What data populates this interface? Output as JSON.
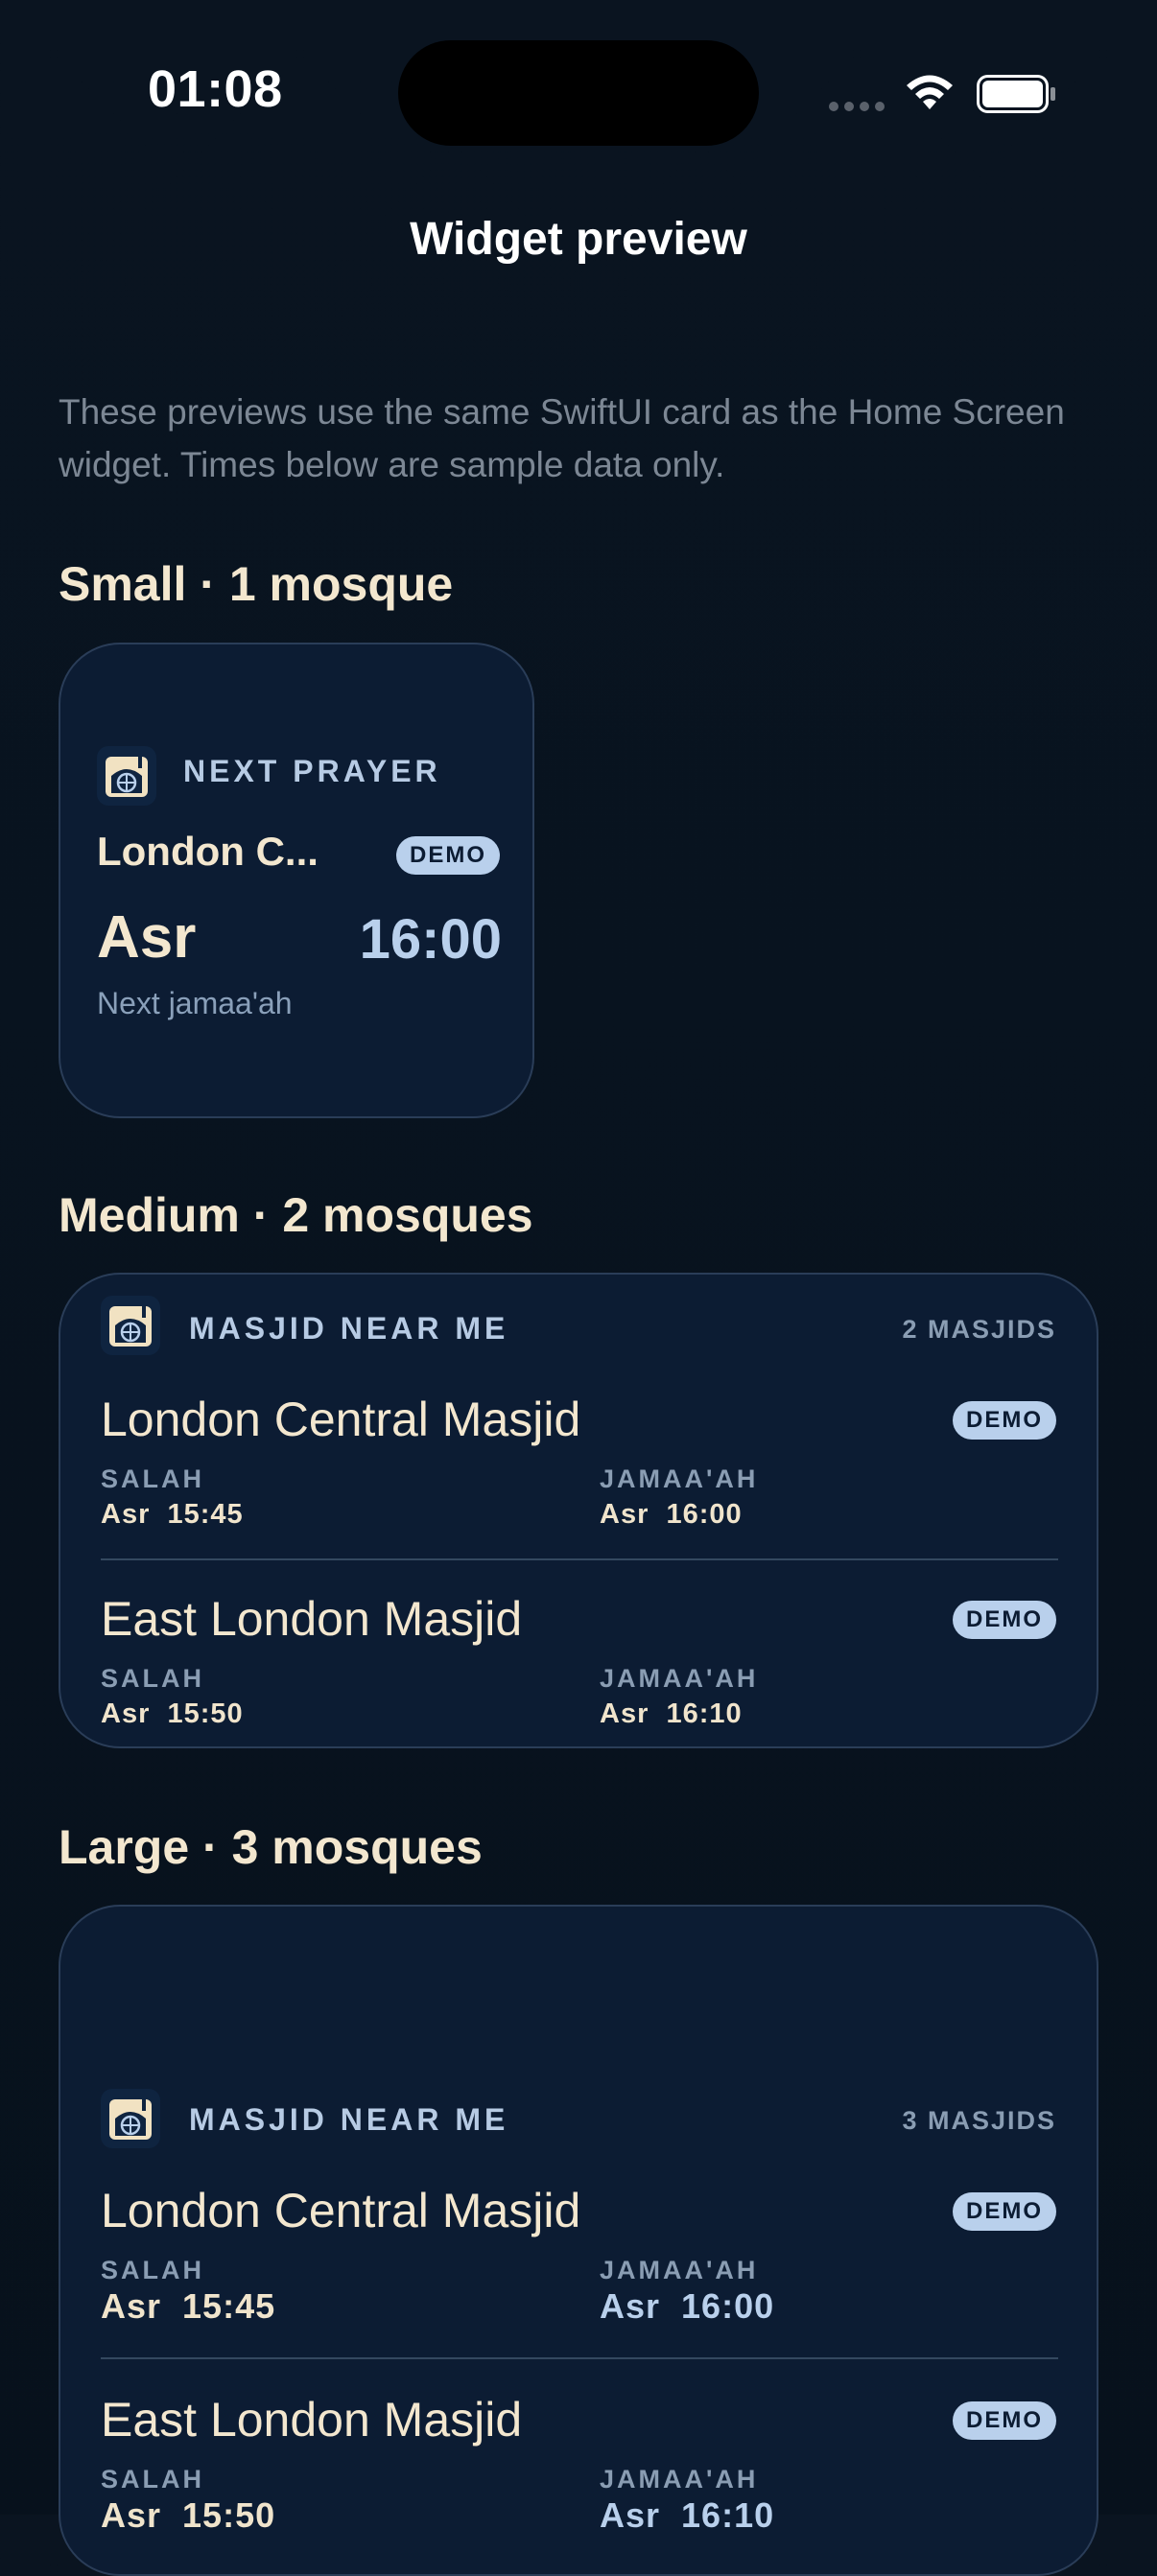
{
  "status_bar": {
    "time": "01:08"
  },
  "nav": {
    "title": "Widget preview"
  },
  "description": "These previews use the same SwiftUI card as the Home Screen widget. Times below are sample data only.",
  "colors": {
    "background": "#08131f",
    "card": "#0c1c33",
    "accent_cream": "#f3e7cf",
    "accent_blue": "#b9d0ec"
  },
  "small": {
    "section_title": "Small · 1 mosque",
    "kicker": "NEXT PRAYER",
    "mosque": "London C...",
    "badge": "DEMO",
    "prayer": "Asr",
    "time": "16:00",
    "caption": "Next jamaa'ah"
  },
  "medium": {
    "section_title": "Medium · 2 mosques",
    "kicker": "MASJID NEAR ME",
    "count": "2 MASJIDS",
    "mosques": [
      {
        "name": "London Central Masjid",
        "badge": "DEMO",
        "salah_label": "SALAH",
        "salah": "Asr  15:45",
        "jamaah_label": "JAMAA'AH",
        "jamaah": "Asr  16:00"
      },
      {
        "name": "East London Masjid",
        "badge": "DEMO",
        "salah_label": "SALAH",
        "salah": "Asr  15:50",
        "jamaah_label": "JAMAA'AH",
        "jamaah": "Asr  16:10"
      }
    ]
  },
  "large": {
    "section_title": "Large · 3 mosques",
    "kicker": "MASJID NEAR ME",
    "count": "3 MASJIDS",
    "mosques": [
      {
        "name": "London Central Masjid",
        "badge": "DEMO",
        "salah_label": "SALAH",
        "salah": "Asr  15:45",
        "jamaah_label": "JAMAA'AH",
        "jamaah": "Asr  16:00"
      },
      {
        "name": "East London Masjid",
        "badge": "DEMO",
        "salah_label": "SALAH",
        "salah": "Asr  15:50",
        "jamaah_label": "JAMAA'AH",
        "jamaah": "Asr  16:10"
      }
    ]
  },
  "icons": {
    "logo": "mosque-logo-icon",
    "wifi": "wifi-icon",
    "battery": "battery-icon",
    "signal": "cellular-signal-icon"
  }
}
